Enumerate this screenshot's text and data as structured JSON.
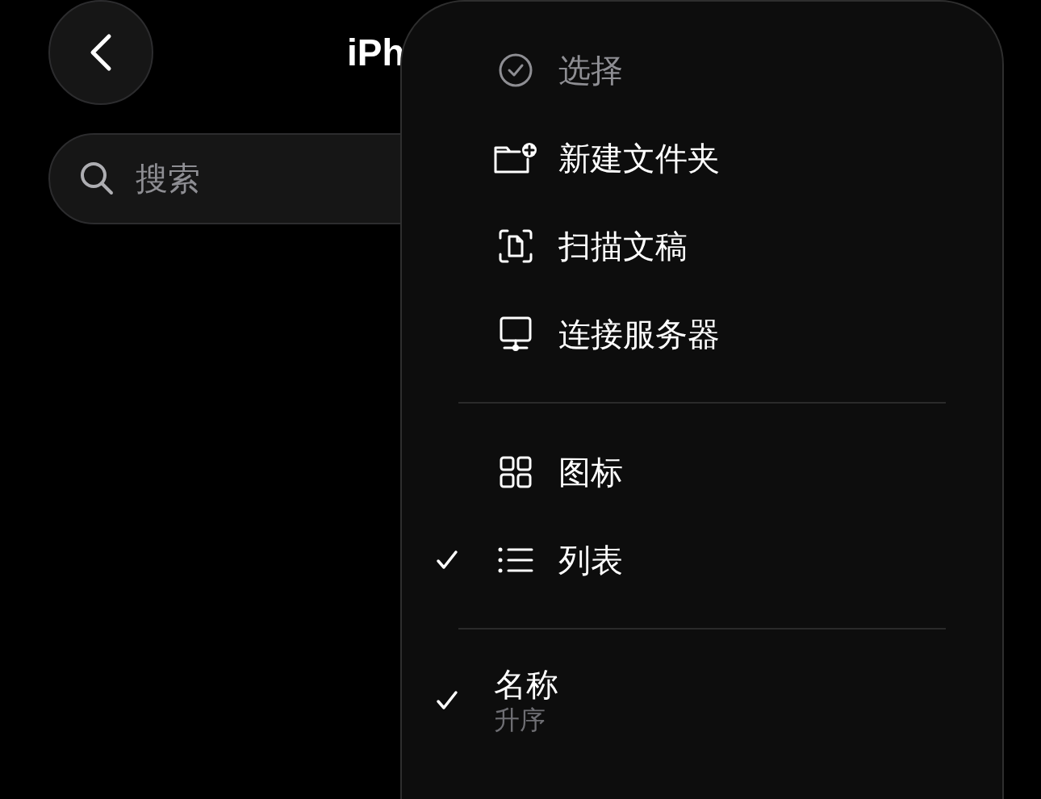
{
  "title": "iPh",
  "search": {
    "placeholder": "搜索"
  },
  "menu": {
    "sections": [
      {
        "items": [
          {
            "kind": "select",
            "label": "选择",
            "disabled": true
          },
          {
            "kind": "folder",
            "label": "新建文件夹",
            "disabled": false
          },
          {
            "kind": "scan",
            "label": "扫描文稿",
            "disabled": false
          },
          {
            "kind": "server",
            "label": "连接服务器",
            "disabled": false
          }
        ]
      },
      {
        "items": [
          {
            "kind": "grid",
            "label": "图标",
            "checked": false
          },
          {
            "kind": "list",
            "label": "列表",
            "checked": true
          }
        ]
      },
      {
        "items": [
          {
            "label": "名称",
            "sublabel": "升序",
            "checked": true
          }
        ]
      }
    ]
  }
}
